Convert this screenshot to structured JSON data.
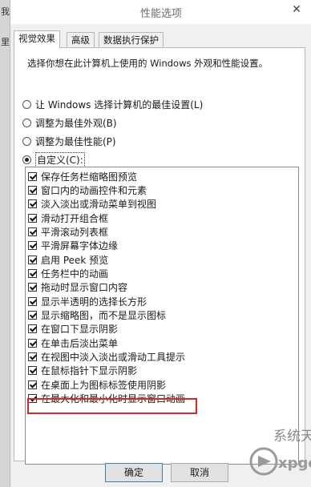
{
  "window": {
    "title": "性能选项"
  },
  "left_fragments": [
    "我",
    "里"
  ],
  "tabs": [
    {
      "label": "视觉效果",
      "active": true
    },
    {
      "label": "高级",
      "active": false
    },
    {
      "label": "数据执行保护",
      "active": false
    }
  ],
  "description": "选择你想在此计算机上使用的 Windows 外观和性能设置。",
  "radios": [
    {
      "label": "让 Windows 选择计算机的最佳设置(L)",
      "selected": false
    },
    {
      "label": "调整为最佳外观(B)",
      "selected": false
    },
    {
      "label": "调整为最佳性能(P)",
      "selected": false
    },
    {
      "label": "自定义(C):",
      "selected": true
    }
  ],
  "options": [
    {
      "label": "保存任务栏缩略图预览",
      "checked": true
    },
    {
      "label": "窗口内的动画控件和元素",
      "checked": true
    },
    {
      "label": "淡入淡出或滑动菜单到视图",
      "checked": true
    },
    {
      "label": "滑动打开组合框",
      "checked": true
    },
    {
      "label": "平滑滚动列表框",
      "checked": true
    },
    {
      "label": "平滑屏幕字体边缘",
      "checked": true
    },
    {
      "label": "启用 Peek 预览",
      "checked": true
    },
    {
      "label": "任务栏中的动画",
      "checked": true
    },
    {
      "label": "拖动时显示窗口内容",
      "checked": true
    },
    {
      "label": "显示半透明的选择长方形",
      "checked": true
    },
    {
      "label": "显示缩略图，而不是显示图标",
      "checked": true
    },
    {
      "label": "在窗口下显示阴影",
      "checked": true
    },
    {
      "label": "在单击后淡出菜单",
      "checked": true
    },
    {
      "label": "在视图中淡入淡出或滑动工具提示",
      "checked": true
    },
    {
      "label": "在鼠标指针下显示阴影",
      "checked": true
    },
    {
      "label": "在桌面上为图标标签使用阴影",
      "checked": true
    },
    {
      "label": "在最大化和最小化时显示窗口动画",
      "checked": true,
      "highlighted": true
    }
  ],
  "buttons": {
    "ok": "确定",
    "cancel": "取消"
  },
  "watermark": {
    "text": "系统天堂",
    "sub": "xpgod",
    "color": "#8a8a8a"
  }
}
